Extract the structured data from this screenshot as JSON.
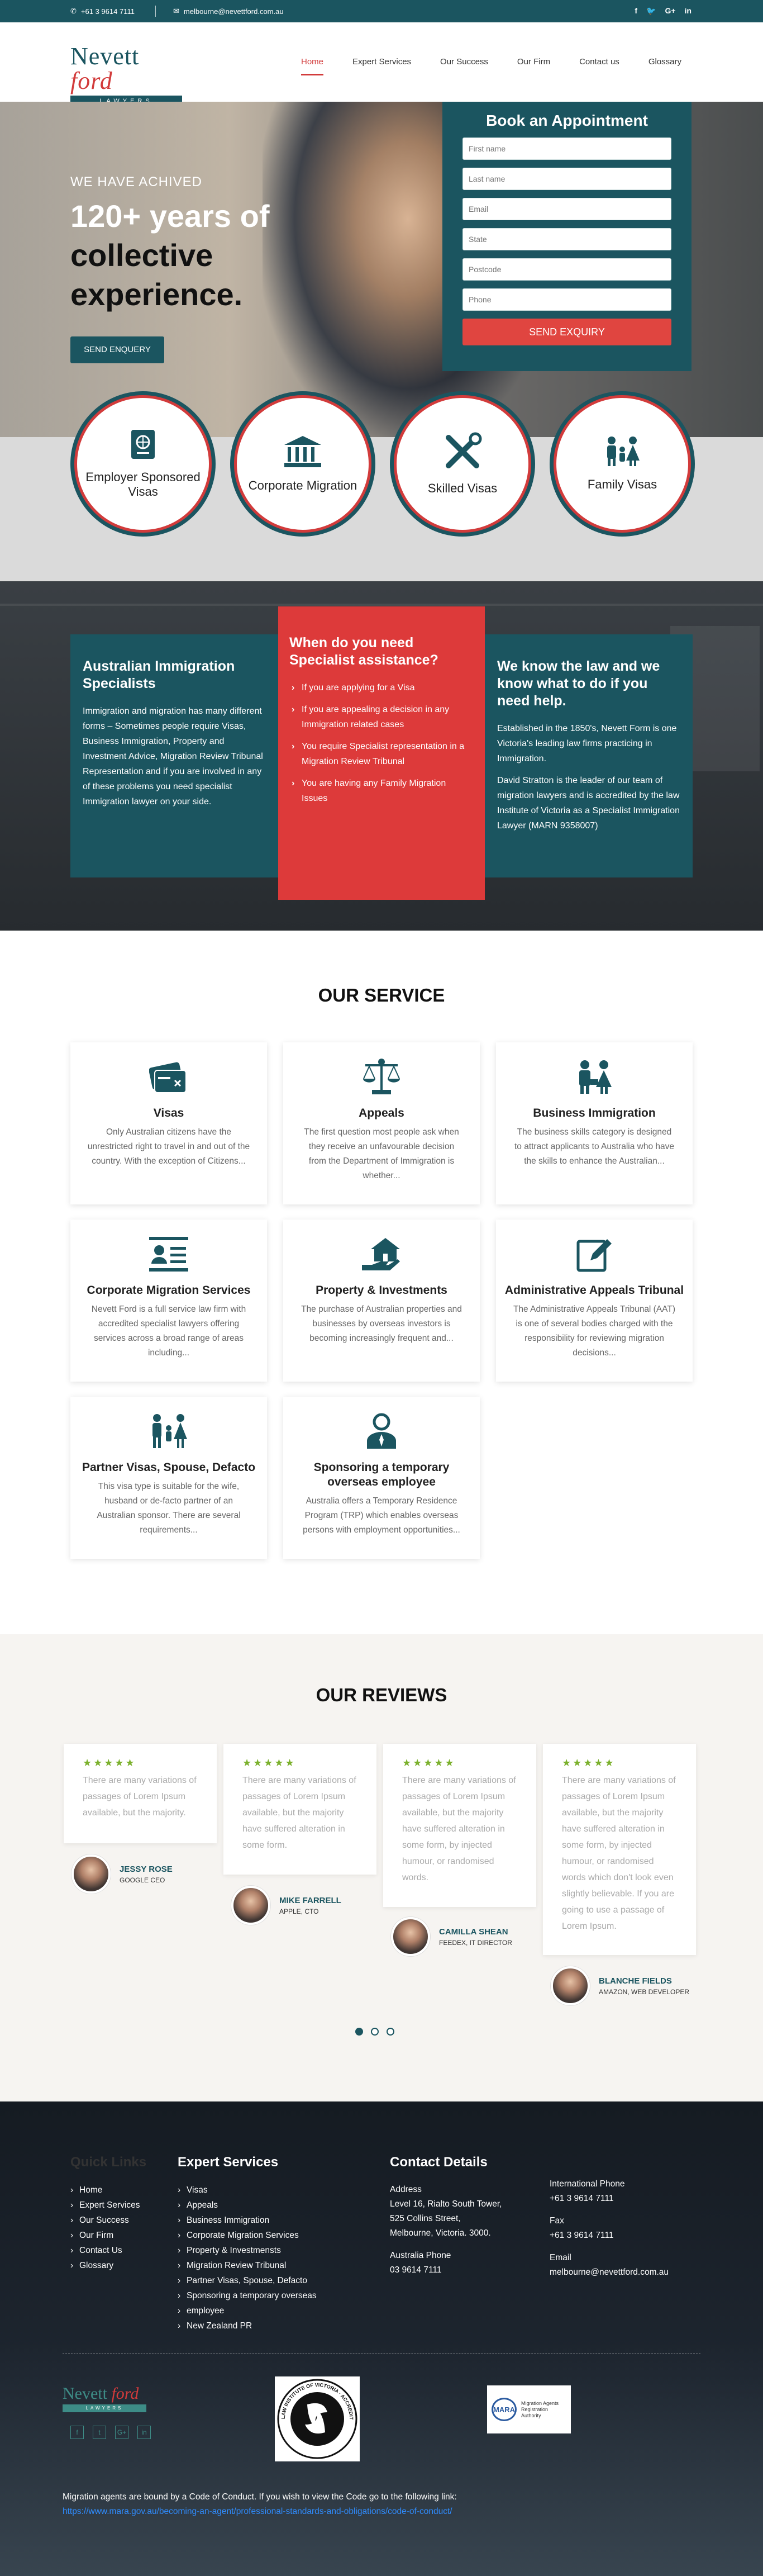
{
  "topbar": {
    "phone": "+61 3 9614 7111",
    "email": "melbourne@nevettford.com.au",
    "socials": [
      "f",
      "🐦",
      "G+",
      "in"
    ]
  },
  "logo": {
    "name_1": "Nevett ",
    "name_2": "ford",
    "tagline": "LAWYERS"
  },
  "nav": [
    "Home",
    "Expert Services",
    "Our Success",
    "Our Firm",
    "Contact us",
    "Glossary"
  ],
  "hero": {
    "small": "WE HAVE ACHIVED",
    "line1": "120+ years of",
    "line2": "collective",
    "line3": "experience.",
    "button": "SEND ENQUERY"
  },
  "appointment": {
    "title": "Book an Appointment",
    "fields": [
      "First name",
      "Last name",
      "Email",
      "State",
      "Postcode",
      "Phone"
    ],
    "button": "SEND EXQUIRY"
  },
  "circles": [
    "Employer Sponsored Visas",
    "Corporate Migration",
    "Skilled Visas",
    "Family Visas"
  ],
  "info": {
    "left_title": "Australian Immigration Specialists",
    "left_text": "Immigration and migration has many different forms – Sometimes people require Visas, Business Immigration, Property and Investment Advice, Migration Review Tribunal Representation and if you are involved in any of these problems you need specialist Immigration lawyer on your side.",
    "mid_title": "When do you need Specialist assistance?",
    "mid_items": [
      "If you are applying for a Visa",
      "If you are appealing a decision in any Immigration related cases",
      "You require Specialist representation in a Migration Review Tribunal",
      "You are having any Family Migration Issues"
    ],
    "right_title": "We know the law and we know what to do if you need help.",
    "right_p1": "Established in the 1850's, Nevett Form is one Victoria's leading law firms practicing in Immigration.",
    "right_p2": "David Stratton is the leader of our team of migration lawyers and is accredited by the law Institute of Victoria as a Specialist Immigration Lawyer (MARN 9358007)"
  },
  "services": {
    "title": "OUR SERVICE",
    "items": [
      {
        "icon": "visa-card-icon",
        "title": "Visas",
        "text": "Only Australian citizens have the unrestricted right to travel in and out of the country. With the exception of Citizens..."
      },
      {
        "icon": "scales-icon",
        "title": "Appeals",
        "text": "The first question most people ask when they receive an unfavourable decision from the Department of Immigration is whether..."
      },
      {
        "icon": "business-people-icon",
        "title": "Business Immigration",
        "text": "The business skills category is designed to attract applicants to Australia who have the skills to enhance the Australian..."
      },
      {
        "icon": "id-card-icon",
        "title": "Corporate Migration Services",
        "text": "Nevett Ford is a full service law firm with accredited specialist lawyers offering services across a broad range of areas including..."
      },
      {
        "icon": "house-hand-icon",
        "title": "Property & Investments",
        "text": "The purchase of Australian properties and businesses by overseas investors is becoming increasingly frequent and..."
      },
      {
        "icon": "edit-form-icon",
        "title": "Administrative Appeals Tribunal",
        "text": "The Administrative Appeals Tribunal (AAT) is one of several bodies charged with the responsibility for reviewing migration decisions..."
      },
      {
        "icon": "family-icon",
        "title": "Partner Visas, Spouse, Defacto",
        "text": "This visa type is suitable for the wife, husband or de-facto partner of an Australian sponsor. There are several requirements..."
      },
      {
        "icon": "employee-icon",
        "title": "Sponsoring a temporary overseas employee",
        "text": "Australia offers a Temporary Residence Program (TRP) which enables overseas persons with employment opportunities..."
      }
    ]
  },
  "reviews": {
    "title": "OUR REVIEWS",
    "stars": "★★★★★",
    "items": [
      {
        "text": "There are many variations of passages of Lorem Ipsum available, but the majority.",
        "name": "JESSY ROSE",
        "role": "GOOGLE CEO"
      },
      {
        "text": "There are many variations of passages of Lorem Ipsum available, but the majority have suffered alteration in some form.",
        "name": "MIKE FARRELL",
        "role": "APPLE, CTO"
      },
      {
        "text": "There are many variations of passages of Lorem Ipsum available, but the majority have suffered alteration in some form, by injected humour, or randomised words.",
        "name": "CAMILLA SHEAN",
        "role": "FEEDEX, IT DIRECTOR"
      },
      {
        "text": "There are many variations of passages of Lorem Ipsum available, but the majority have suffered alteration in some form, by injected humour, or randomised words which don't look even slightly believable. If you are going to use a passage of Lorem Ipsum.",
        "name": "BLANCHE FIELDS",
        "role": "AMAZON, WEB DEVELOPER"
      }
    ]
  },
  "footer": {
    "quick_title": "Quick Links",
    "quick_links": [
      "Home",
      "Expert Services",
      "Our Success",
      "Our Firm",
      "Contact Us",
      "Glossary"
    ],
    "expert_title": "Expert Services",
    "expert_links": [
      "Visas",
      "Appeals",
      "Business Immigration",
      "Corporate Migration Services",
      "Property & Investmensts",
      "Migration Review Tribunal",
      "Partner Visas, Spouse, Defacto",
      "Sponsoring a temporary overseas",
      "employee",
      "New Zealand PR"
    ],
    "contact_title": "Contact Details",
    "address_label": "Address",
    "address": [
      "Level 16, Rialto South Tower,",
      "525 Collins Street,",
      "Melbourne, Victoria. 3000."
    ],
    "au_phone_label": "Australia Phone",
    "au_phone": "03 9614 7111",
    "intl_label": "International Phone",
    "intl_phone": "+61 3 9614 7111",
    "fax_label": "Fax",
    "fax": "+61 3 9614 7111",
    "email_label": "Email",
    "email": "melbourne@nevettford.com.au",
    "socials": [
      "f",
      "t",
      "G+",
      "in"
    ],
    "badge_liv": "LAW INSTITUTE OF VICTORIA · ACCREDITED SPECIALIST ·",
    "badge_mara": "Migration Agents Registration Authority",
    "conduct": "Migration agents are bound by a Code of Conduct. If you wish to view the Code go to the following link:",
    "conduct_link": "https://www.mara.gov.au/becoming-an-agent/professional-standards-and-obligations/code-of-conduct/"
  }
}
